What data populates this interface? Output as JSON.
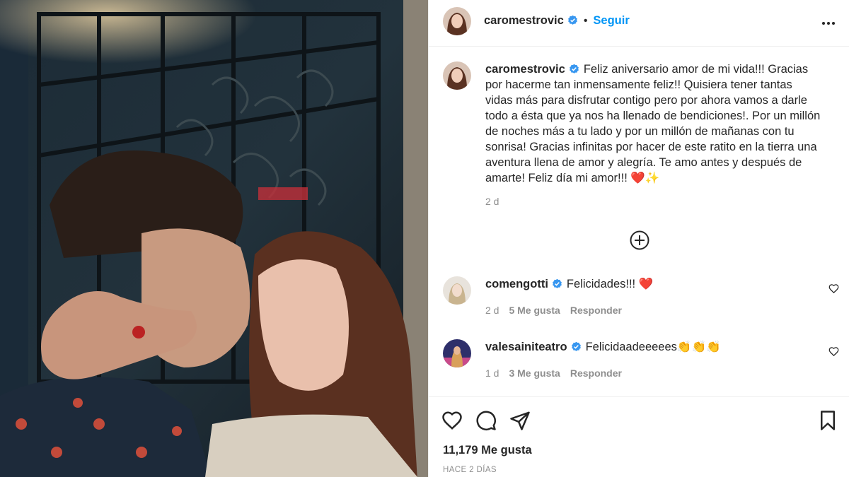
{
  "post": {
    "photo_alt": "selfie-kiss-photo"
  },
  "header": {
    "username": "caromestrovic",
    "dot": "•",
    "follow_label": "Seguir",
    "more_icon": "more-options-icon"
  },
  "caption": {
    "username": "caromestrovic",
    "text": "Feliz aniversario amor de mi vida!!! Gracias por hacerme tan inmensamente feliz!! Quisiera tener tantas vidas más para disfrutar contigo pero por ahora vamos a darle todo a ésta que ya nos ha llenado de bendiciones!. Por un millón de noches más a tu lado y por un millón de mañanas con tu sonrisa! Gracias infinitas por hacer de este ratito en la tierra una aventura llena de amor y alegría. Te amo antes y después de amarte! Feliz día mi amor!!! ❤️✨",
    "time": "2 d"
  },
  "comments": [
    {
      "username": "comengotti",
      "text": "Felicidades!!! ❤️",
      "time": "2 d",
      "likes": "5 Me gusta",
      "reply": "Responder"
    },
    {
      "username": "valesainiteatro",
      "text": "Felicidaadeeeees👏👏👏",
      "time": "1 d",
      "likes": "3 Me gusta",
      "reply": "Responder"
    }
  ],
  "footer": {
    "likes": "11,179 Me gusta",
    "ago": "HACE 2 DÍAS"
  },
  "colors": {
    "accent": "#0095f6",
    "text": "#262626",
    "secondary": "#8e8e8e",
    "verified": "#3897f0"
  }
}
